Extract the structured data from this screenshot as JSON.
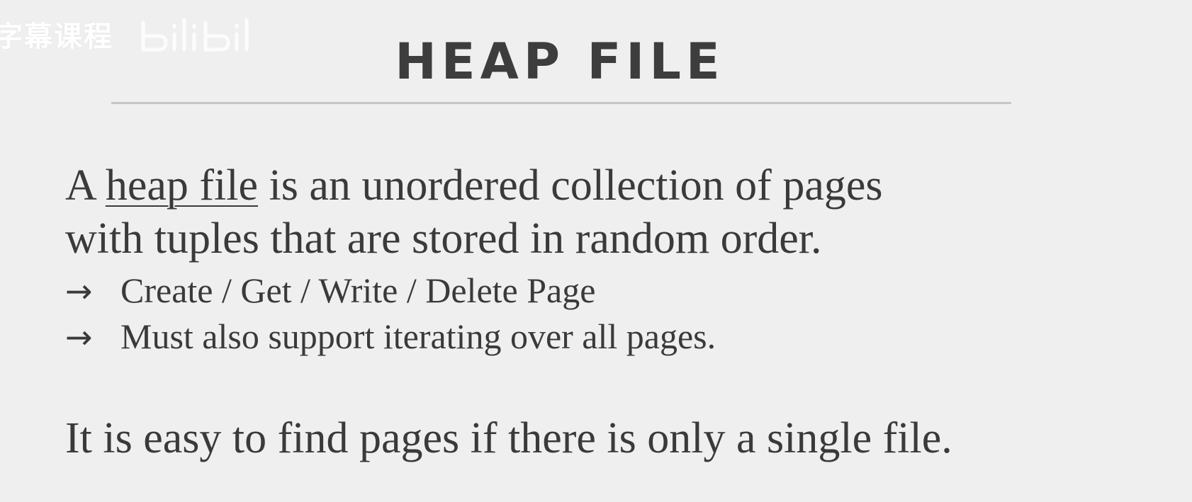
{
  "watermark": {
    "text": "字幕课程",
    "logo_icon": "bilibili-logo"
  },
  "slide": {
    "title": "HEAP FILE",
    "para1": {
      "prefix": "A ",
      "term": "heap file",
      "rest_line1": " is an unordered collection of pages",
      "line2": "with tuples that are stored in random order."
    },
    "bullets": [
      {
        "arrow": "→",
        "text": "Create / Get / Write / Delete Page"
      },
      {
        "arrow": "→",
        "text": "Must also support iterating over all pages."
      }
    ],
    "para2": "It is easy to find pages if there is only a single file."
  },
  "colors": {
    "background": "#efefef",
    "text": "#3a3a3a",
    "rule": "#c6c6c6"
  }
}
